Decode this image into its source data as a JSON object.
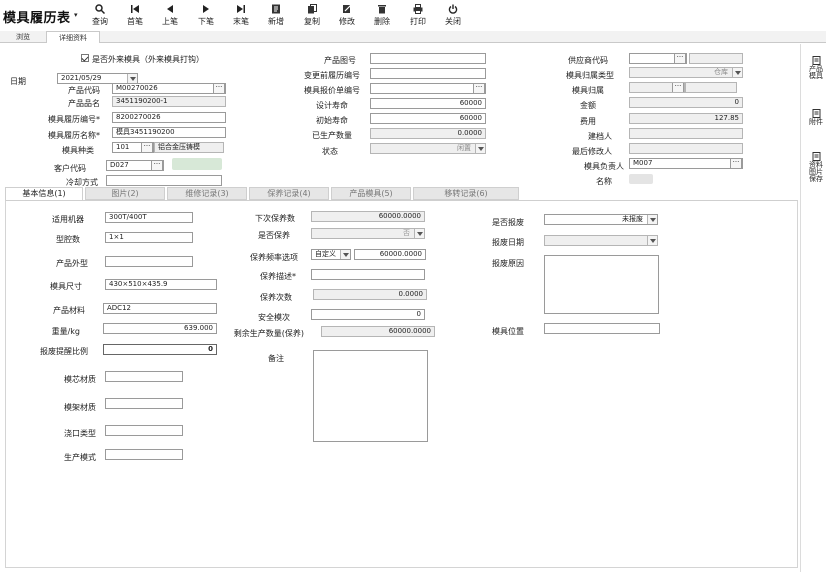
{
  "app": {
    "title": "模具履历表"
  },
  "toolbar": [
    {
      "name": "query",
      "label": "查询",
      "icon": "search-icon"
    },
    {
      "name": "first",
      "label": "首笔",
      "icon": "first-icon"
    },
    {
      "name": "prev",
      "label": "上笔",
      "icon": "prev-icon"
    },
    {
      "name": "next",
      "label": "下笔",
      "icon": "next-icon"
    },
    {
      "name": "last",
      "label": "末笔",
      "icon": "last-icon"
    },
    {
      "name": "new",
      "label": "新增",
      "icon": "new-doc-icon"
    },
    {
      "name": "copy",
      "label": "复制",
      "icon": "copy-icon"
    },
    {
      "name": "edit",
      "label": "修改",
      "icon": "edit-icon"
    },
    {
      "name": "delete",
      "label": "删除",
      "icon": "trash-icon"
    },
    {
      "name": "print",
      "label": "打印",
      "icon": "printer-icon"
    },
    {
      "name": "close",
      "label": "关闭",
      "icon": "power-icon"
    }
  ],
  "top_tabs": {
    "browse": "浏览",
    "detail": "详细资料"
  },
  "header": {
    "external_check_label": "是否外来模具（外来模具打钩）",
    "date_label": "日期",
    "date_value": "2021/05/29",
    "product_code_label": "产品代码",
    "product_code": "M00270026",
    "product_name_label": "产品品名",
    "product_name": "3451190200-1",
    "mold_no_label": "模具履历编号*",
    "mold_no": "8200270026",
    "mold_name_label": "模具履历名称*",
    "mold_name": "模具3451190200",
    "mold_type_label": "模具种类",
    "mold_type_code": "101",
    "mold_type_name": "铝合金压铸模",
    "customer_code_label": "客户代码",
    "customer_code": "D027",
    "cooling_label": "冷却方式",
    "drawing_no_label": "产品图号",
    "change_prev_no_label": "变更前履历编号",
    "quote_no_label": "模具报价单编号",
    "design_life_label": "设计寿命",
    "design_life": "60000",
    "initial_life_label": "初始寿命",
    "initial_life": "60000",
    "produced_label": "已生产数量",
    "produced": "0.0000",
    "status_label": "状态",
    "status_value": "闲置",
    "supplier_code_label": "供应商代码",
    "category_label": "模具归属类型",
    "category_value": "仓库",
    "owner_label": "模具归属",
    "amount_label": "金额",
    "amount": "0",
    "cost_label": "费用",
    "cost": "127.85",
    "builder_label": "建档人",
    "last_modifier_label": "最后修改人",
    "manager_label": "模具负责人",
    "manager": "M007",
    "name_label": "名称"
  },
  "main_tabs": [
    "基本信息(1)",
    "图片(2)",
    "维修记录(3)",
    "保养记录(4)",
    "产品模具(5)",
    "移转记录(6)"
  ],
  "basic": {
    "machine_label": "适用机器",
    "machine": "300T/400T",
    "cavity_label": "型腔数",
    "cavity": "1×1",
    "shape_label": "产品外型",
    "size_label": "模具尺寸",
    "size": "430×510×435.9",
    "material_label": "产品材料",
    "material": "ADC12",
    "weight_label": "重量/kg",
    "weight": "639.000",
    "scrap_ratio_label": "报废提醒比例",
    "scrap_ratio": "0",
    "core_material_label": "模芯材质",
    "frame_material_label": "模架材质",
    "gate_type_label": "浇口类型",
    "prod_mode_label": "生产模式",
    "next_maint_label": "下次保养数",
    "next_maint": "60000.0000",
    "need_maint_label": "是否保养",
    "need_maint": "否",
    "freq_label": "保养频率选项",
    "freq_option": "自定义",
    "freq_value": "60000.0000",
    "maint_desc_label": "保养描述*",
    "maint_count_label": "保养次数",
    "maint_count": "0.0000",
    "safety_stock_label": "安全模次",
    "safety_stock": "0",
    "remain_label": "剩余生产数量(保养)",
    "remain": "60000.0000",
    "note_label": "备注",
    "scrapped_label": "是否报废",
    "scrapped": "未报废",
    "scrap_date_label": "报废日期",
    "scrap_reason_label": "报废原因",
    "location_label": "模具位置"
  },
  "right_panel": [
    "产品模具",
    "附件",
    "资料图片保存"
  ]
}
